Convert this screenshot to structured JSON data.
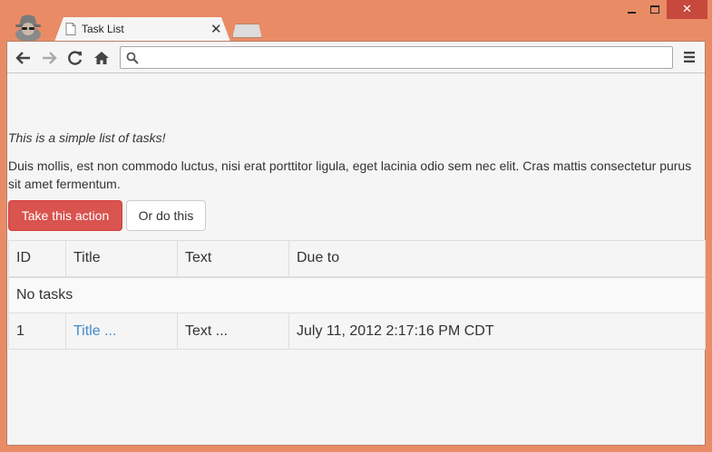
{
  "browser": {
    "tab_title": "Task List",
    "address_value": "",
    "accent_color": "#e98c65",
    "icons": [
      "incognito-icon",
      "page-icon",
      "close-icon",
      "back-icon",
      "forward-icon",
      "reload-icon",
      "home-icon",
      "search-icon",
      "menu-icon"
    ]
  },
  "page": {
    "lead": "This is a simple list of tasks!",
    "paragraph": "Duis mollis, est non commodo luctus, nisi erat porttitor ligula, eget lacinia odio sem nec elit. Cras mattis consectetur purus sit amet fermentum.",
    "primary_button": "Take this action",
    "secondary_button": "Or do this",
    "primary_color": "#d9534f",
    "link_color": "#428bca"
  },
  "table": {
    "headers": [
      "ID",
      "Title",
      "Text",
      "Due to"
    ],
    "empty_message": "No tasks",
    "rows": [
      {
        "id": "1",
        "title": "Title ...",
        "text": "Text ...",
        "due": "July 11, 2012 2:17:16 PM CDT"
      }
    ]
  }
}
